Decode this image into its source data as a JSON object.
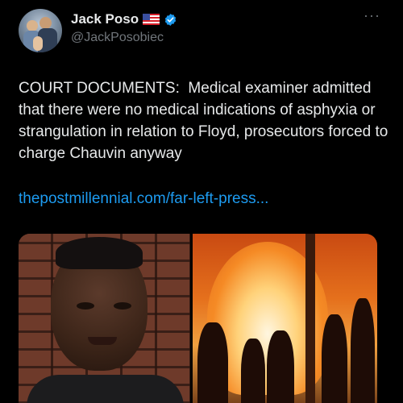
{
  "author": {
    "display_name": "Jack Poso",
    "flag_icon": "us-flag-icon",
    "verified_icon": "verified-badge-icon",
    "handle": "@JackPosobiec"
  },
  "more_label": "···",
  "tweet": {
    "text": "COURT DOCUMENTS:  Medical examiner admitted that there were no medical indications of asphyxia or strangulation in relation to Floyd, prosecutors forced to charge Chauvin anyway",
    "link": "thepostmillennial.com/far-left-press..."
  },
  "media": {
    "left_image": "portrait-photo",
    "right_image": "fire-scene-photo"
  },
  "colors": {
    "background": "#000000",
    "text": "#e7e9ea",
    "secondary_text": "#71767b",
    "link": "#1d9bf0",
    "verified": "#1d9bf0"
  }
}
